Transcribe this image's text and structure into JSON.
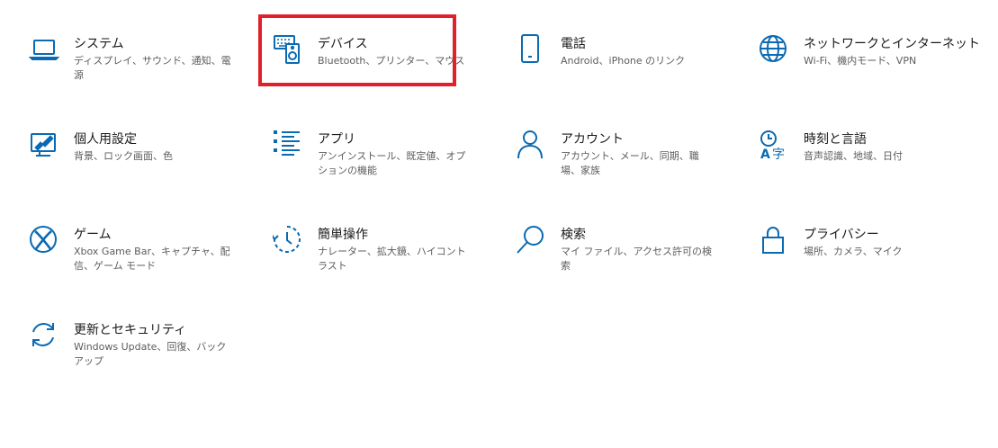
{
  "accent_color": "#0a6ab2",
  "highlight_color": "#e0202a",
  "tiles": [
    {
      "icon": "laptop-icon",
      "title": "システム",
      "desc": "ディスプレイ、サウンド、通知、電源"
    },
    {
      "icon": "devices-icon",
      "title": "デバイス",
      "desc": "Bluetooth、プリンター、マウス"
    },
    {
      "icon": "phone-icon",
      "title": "電話",
      "desc": "Android、iPhone のリンク"
    },
    {
      "icon": "globe-icon",
      "title": "ネットワークとインターネット",
      "desc": "Wi-Fi、機内モード、VPN"
    },
    {
      "icon": "personalization-icon",
      "title": "個人用設定",
      "desc": "背景、ロック画面、色"
    },
    {
      "icon": "apps-list-icon",
      "title": "アプリ",
      "desc": "アンインストール、既定値、オプションの機能"
    },
    {
      "icon": "person-icon",
      "title": "アカウント",
      "desc": "アカウント、メール、同期、職場、家族"
    },
    {
      "icon": "time-language-icon",
      "title": "時刻と言語",
      "desc": "音声認識、地域、日付"
    },
    {
      "icon": "xbox-icon",
      "title": "ゲーム",
      "desc": "Xbox Game Bar、キャプチャ、配信、ゲーム モード"
    },
    {
      "icon": "ease-of-access-icon",
      "title": "簡単操作",
      "desc": "ナレーター、拡大鏡、ハイコントラスト"
    },
    {
      "icon": "search-icon",
      "title": "検索",
      "desc": "マイ ファイル、アクセス許可の検索"
    },
    {
      "icon": "lock-icon",
      "title": "プライバシー",
      "desc": "場所、カメラ、マイク"
    },
    {
      "icon": "sync-icon",
      "title": "更新とセキュリティ",
      "desc": "Windows Update、回復、バックアップ"
    }
  ]
}
